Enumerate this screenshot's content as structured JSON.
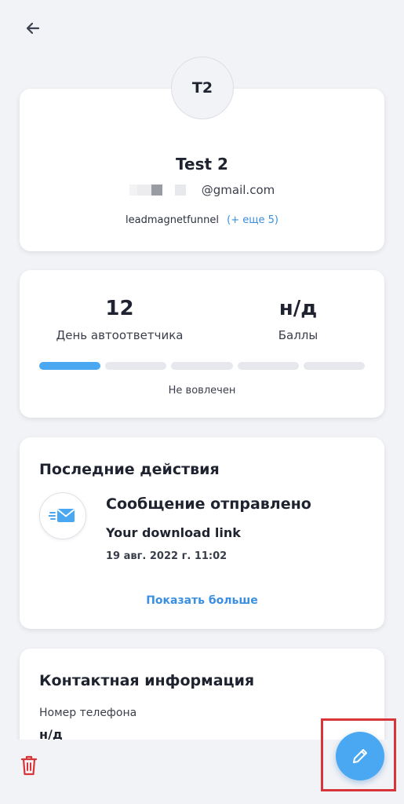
{
  "header": {
    "back_icon": "arrow-left-icon"
  },
  "profile": {
    "initials": "T2",
    "name": "Test 2",
    "email_domain": "@gmail.com",
    "tag": "leadmagnetfunnel",
    "more_tags": "(+ еще 5)"
  },
  "stats": {
    "autoresponder_day_value": "12",
    "autoresponder_day_label": "День автоответчика",
    "points_value": "н/д",
    "points_label": "Баллы",
    "engagement_progress": 0.2,
    "engagement_status": "Не вовлечен"
  },
  "activity": {
    "section_title": "Последние действия",
    "items": [
      {
        "icon": "mail-sent-icon",
        "title": "Сообщение отправлено",
        "subject": "Your download link",
        "date": "19 авг. 2022 г. 11:02"
      }
    ],
    "show_more": "Показать больше"
  },
  "contact": {
    "section_title": "Контактная информация",
    "phone_label": "Номер телефона",
    "phone_value": "н/д"
  },
  "bottom_bar": {
    "delete_icon": "trash-icon",
    "edit_icon": "pencil-icon"
  },
  "colors": {
    "accent": "#4aa8f2",
    "link": "#3a8fe0",
    "danger": "#d8353a",
    "background": "#f2f3f6"
  }
}
